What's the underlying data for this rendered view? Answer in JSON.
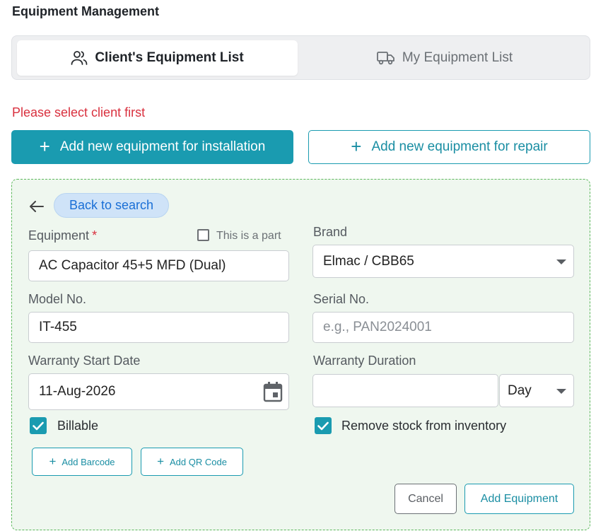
{
  "page": {
    "title": "Equipment Management"
  },
  "tabs": [
    {
      "label": "Client's Equipment List",
      "icon": "users-icon",
      "active": true
    },
    {
      "label": "My Equipment List",
      "icon": "truck-icon",
      "active": false
    }
  ],
  "alert": {
    "message": "Please select client first",
    "color": "#d9303e"
  },
  "actions": {
    "install_label": "Add new equipment for installation",
    "repair_label": "Add new equipment for repair"
  },
  "form": {
    "back_label": "Back to search",
    "equipment": {
      "label": "Equipment",
      "required_mark": "*",
      "value": "AC Capacitor 45+5 MFD (Dual)",
      "part_checkbox_label": "This is a part",
      "is_part": false
    },
    "brand": {
      "label": "Brand",
      "value": "Elmac / CBB65"
    },
    "model": {
      "label": "Model No.",
      "value": "IT-455"
    },
    "serial": {
      "label": "Serial No.",
      "value": "",
      "placeholder": "e.g., PAN2024001"
    },
    "warranty_start": {
      "label": "Warranty Start Date",
      "value": "11-Aug-2026"
    },
    "warranty_duration": {
      "label": "Warranty Duration",
      "value": "",
      "unit": "Day"
    },
    "billable": {
      "label": "Billable",
      "checked": true
    },
    "remove_stock": {
      "label": "Remove stock from inventory",
      "checked": true
    },
    "add_barcode_label": "Add Barcode",
    "add_qr_label": "Add QR Code",
    "cancel_label": "Cancel",
    "submit_label": "Add Equipment"
  },
  "colors": {
    "accent": "#1a9bb0",
    "panel_bg": "#eff7ef",
    "panel_border": "#5cb85c",
    "chip_bg": "#cfe3f8"
  }
}
